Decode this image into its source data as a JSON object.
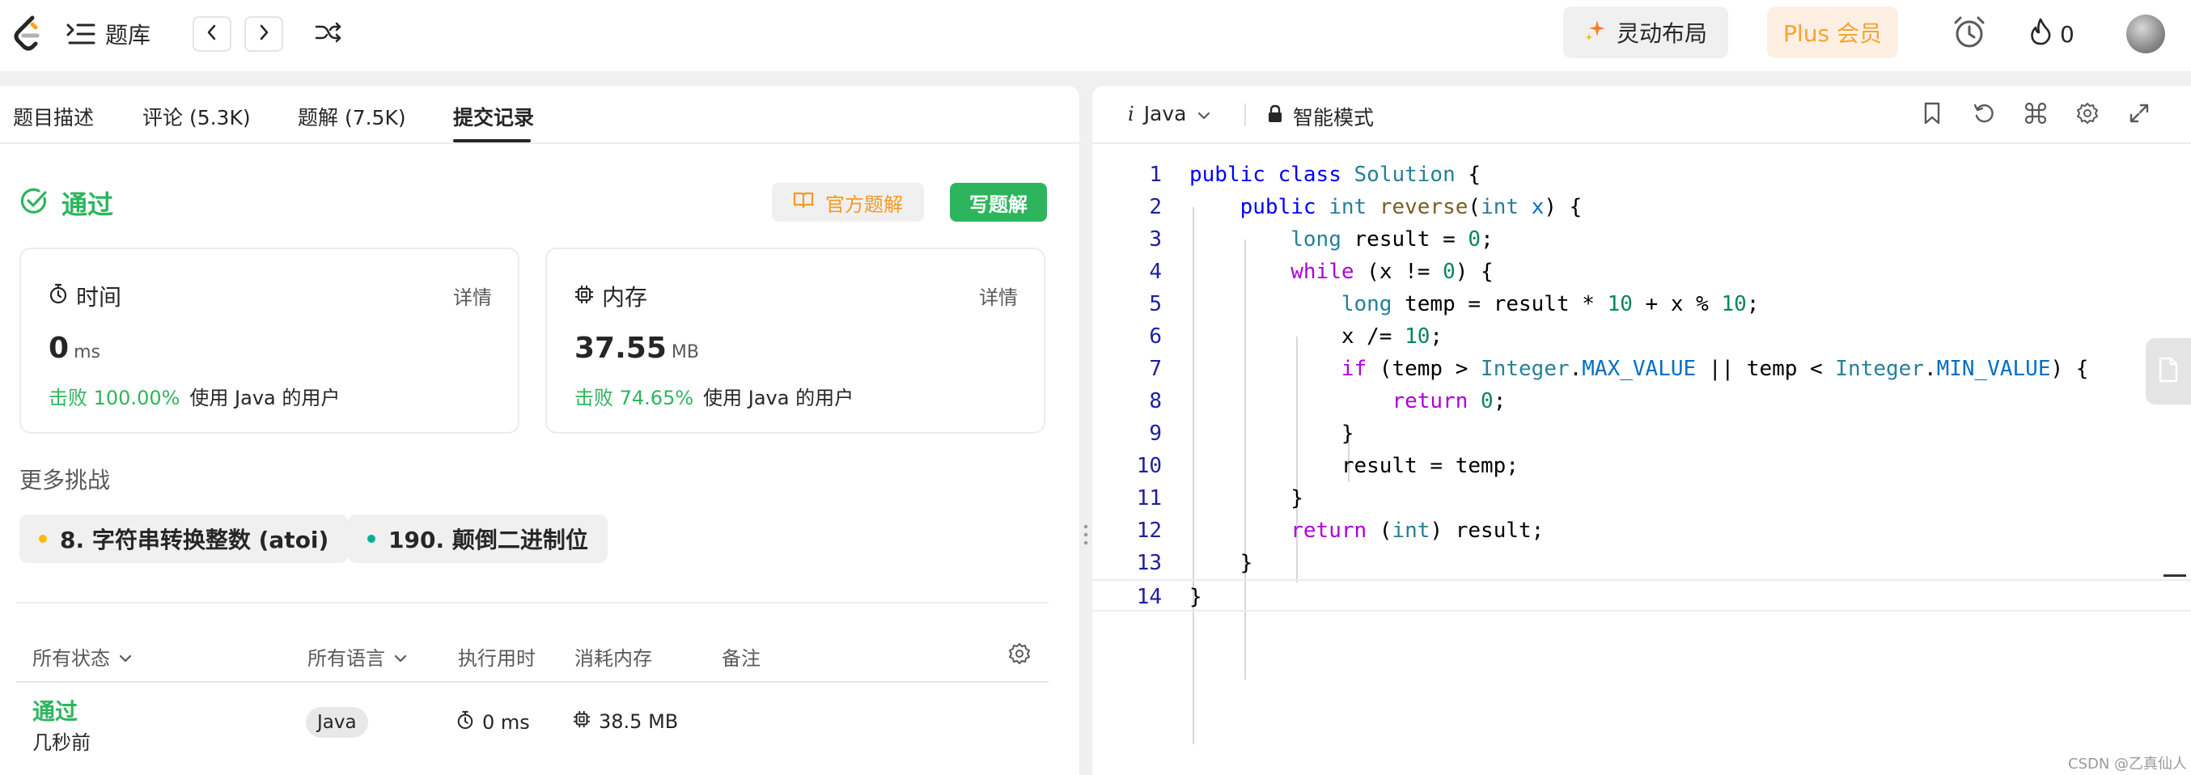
{
  "topbar": {
    "problems_label": "题库",
    "dynamic_layout_label": "灵动布局",
    "plus_label": "Plus 会员",
    "streak_count": "0"
  },
  "tabs": [
    {
      "label": "题目描述"
    },
    {
      "label": "评论 (5.3K)"
    },
    {
      "label": "题解 (7.5K)"
    },
    {
      "label": "提交记录"
    }
  ],
  "result": {
    "status": "通过",
    "official_solution_label": "官方题解",
    "write_solution_label": "写题解"
  },
  "runtime_card": {
    "title": "时间",
    "detail_label": "详情",
    "value": "0",
    "unit": "ms",
    "beat_pct": "击败 100.00%",
    "beat_suffix": "使用 Java 的用户"
  },
  "memory_card": {
    "title": "内存",
    "detail_label": "详情",
    "value": "37.55",
    "unit": "MB",
    "beat_pct": "击败 74.65%",
    "beat_suffix": "使用 Java 的用户"
  },
  "more_challenges": {
    "title": "更多挑战",
    "items": [
      {
        "label": "8. 字符串转换整数 (atoi)",
        "dot_color": "#ffb800"
      },
      {
        "label": "190. 颠倒二进制位",
        "dot_color": "#00af9b"
      }
    ]
  },
  "submissions": {
    "headers": {
      "status": "所有状态",
      "language": "所有语言",
      "runtime": "执行用时",
      "memory": "消耗内存",
      "notes": "备注"
    },
    "rows": [
      {
        "status": "通过",
        "time": "几秒前",
        "language": "Java",
        "runtime": "0 ms",
        "memory": "38.5 MB"
      }
    ]
  },
  "editor": {
    "language": "Java",
    "mode_label": "智能模式",
    "line_numbers": [
      "1",
      "2",
      "3",
      "4",
      "5",
      "6",
      "7",
      "8",
      "9",
      "10",
      "11",
      "12",
      "13",
      "14"
    ]
  },
  "watermark": "CSDN @乙真仙人",
  "colors": {
    "accepted_green": "#2db55d",
    "plus_orange": "#f7a233",
    "keyword_blue": "#0000ff",
    "control_purple": "#af00db",
    "number_green": "#098658"
  }
}
